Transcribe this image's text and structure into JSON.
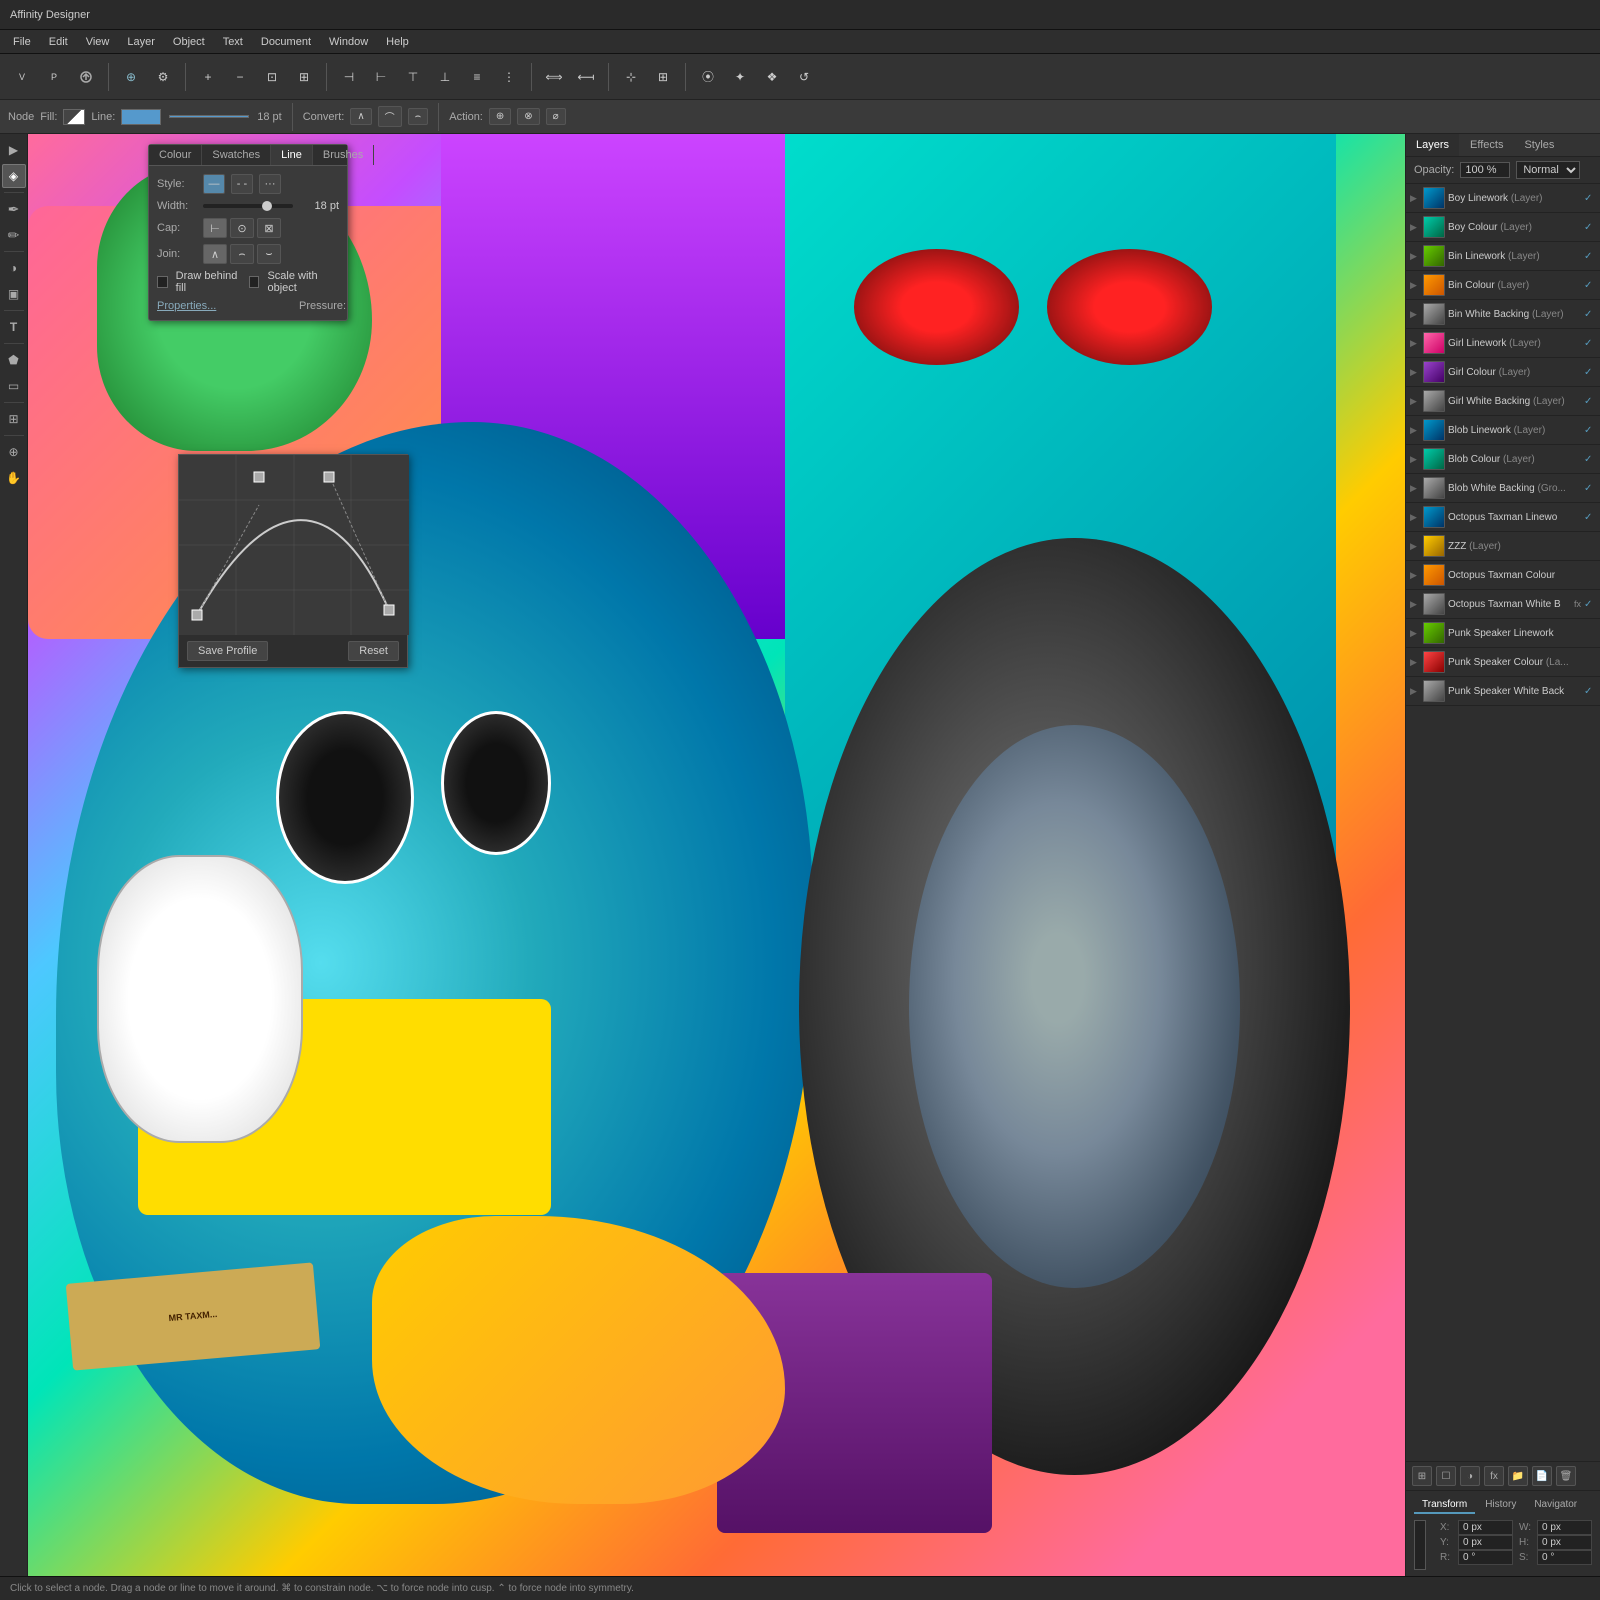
{
  "app": {
    "title": "Affinity Designer",
    "menu": [
      "File",
      "Edit",
      "View",
      "Layer",
      "Object",
      "Text",
      "Document",
      "Window",
      "Help"
    ]
  },
  "context_toolbar": {
    "node_label": "Node",
    "fill_label": "Fill:",
    "line_label": "Line:",
    "line_width": "18 pt",
    "convert_label": "Convert:",
    "action_label": "Action:"
  },
  "stroke_panel": {
    "tabs": [
      "Colour",
      "Swatches",
      "Line",
      "Brushes"
    ],
    "active_tab": "Line",
    "style_label": "Style:",
    "width_label": "Width:",
    "width_value": "18 pt",
    "cap_label": "Cap:",
    "join_label": "Join:",
    "draw_behind_fill": "Draw behind fill",
    "scale_object": "Scale with object",
    "properties_link": "Properties...",
    "pressure_label": "Pressure:"
  },
  "pressure_popup": {
    "save_profile": "Save Profile",
    "reset": "Reset"
  },
  "right_panel": {
    "tabs": [
      "Layers",
      "Effects",
      "Styles"
    ],
    "active_tab": "Layers",
    "opacity_label": "Opacity:",
    "opacity_value": "100 %",
    "blend_mode": "Normal",
    "layers": [
      {
        "name": "Boy Linework",
        "type": "Layer",
        "visible": true,
        "color": "blue",
        "indent": 0
      },
      {
        "name": "Boy Colour",
        "type": "Layer",
        "visible": true,
        "color": "teal",
        "indent": 0
      },
      {
        "name": "Bin Linework",
        "type": "Layer",
        "visible": true,
        "color": "green",
        "indent": 0
      },
      {
        "name": "Bin Colour",
        "type": "Layer",
        "visible": true,
        "color": "orange",
        "indent": 0
      },
      {
        "name": "Bin White Backing",
        "type": "Layer",
        "visible": true,
        "color": "gray",
        "indent": 0
      },
      {
        "name": "Girl Linework",
        "type": "Layer",
        "visible": true,
        "color": "pink",
        "indent": 0
      },
      {
        "name": "Girl Colour",
        "type": "Layer",
        "visible": true,
        "color": "purple",
        "indent": 0
      },
      {
        "name": "Girl White Backing",
        "type": "Layer",
        "visible": true,
        "color": "gray",
        "indent": 0
      },
      {
        "name": "Blob Linework",
        "type": "Layer",
        "visible": true,
        "color": "blue",
        "indent": 0
      },
      {
        "name": "Blob Colour",
        "type": "Layer",
        "visible": true,
        "color": "teal",
        "indent": 0
      },
      {
        "name": "Blob White Backing",
        "type": "Gro...",
        "visible": true,
        "color": "gray",
        "indent": 0
      },
      {
        "name": "Octopus Taxman Linewo",
        "type": "",
        "visible": true,
        "color": "blue",
        "indent": 0
      },
      {
        "name": "ZZZ",
        "type": "Layer",
        "visible": false,
        "color": "yellow",
        "indent": 0
      },
      {
        "name": "Octopus Taxman Colour",
        "type": "",
        "visible": false,
        "color": "orange",
        "indent": 0
      },
      {
        "name": "Octopus Taxman White B",
        "type": "",
        "fx": true,
        "visible": true,
        "color": "gray",
        "indent": 0
      },
      {
        "name": "Punk Speaker Linework",
        "type": "",
        "visible": false,
        "color": "green",
        "indent": 0
      },
      {
        "name": "Punk Speaker Colour",
        "type": "La...",
        "visible": false,
        "color": "red",
        "indent": 0
      },
      {
        "name": "Punk Speaker White Back",
        "type": "",
        "visible": true,
        "color": "gray",
        "indent": 0
      }
    ]
  },
  "transform_panel": {
    "tabs": [
      "Transform",
      "History",
      "Navigator"
    ],
    "active_tab": "Transform",
    "x_label": "X:",
    "x_value": "0 px",
    "y_label": "Y:",
    "y_value": "0 px",
    "w_label": "W:",
    "w_value": "0 px",
    "h_label": "H:",
    "h_value": "0 px",
    "r_label": "R:",
    "r_value": "0 °",
    "s_label": "S:",
    "s_value": "0 °"
  },
  "status_bar": {
    "text": "Click to select a node. Drag a node or line to move it around. ⌘ to constrain node. ⌥ to force node into cusp. ⌃ to force node into symmetry."
  },
  "tools": [
    {
      "name": "move-tool",
      "icon": "▶",
      "active": false
    },
    {
      "name": "node-tool",
      "icon": "◈",
      "active": true
    },
    {
      "name": "pen-tool",
      "icon": "✒",
      "active": false
    },
    {
      "name": "pencil-tool",
      "icon": "✏",
      "active": false
    },
    {
      "name": "brush-tool",
      "icon": "⬡",
      "active": false
    },
    {
      "name": "fill-tool",
      "icon": "◑",
      "active": false
    },
    {
      "name": "gradient-tool",
      "icon": "▣",
      "active": false
    },
    {
      "name": "text-tool",
      "icon": "T",
      "active": false
    },
    {
      "name": "shape-tool",
      "icon": "⬟",
      "active": false
    },
    {
      "name": "crop-tool",
      "icon": "⊞",
      "active": false
    },
    {
      "name": "zoom-tool",
      "icon": "⊕",
      "active": false
    },
    {
      "name": "hand-tool",
      "icon": "✋",
      "active": false
    }
  ]
}
